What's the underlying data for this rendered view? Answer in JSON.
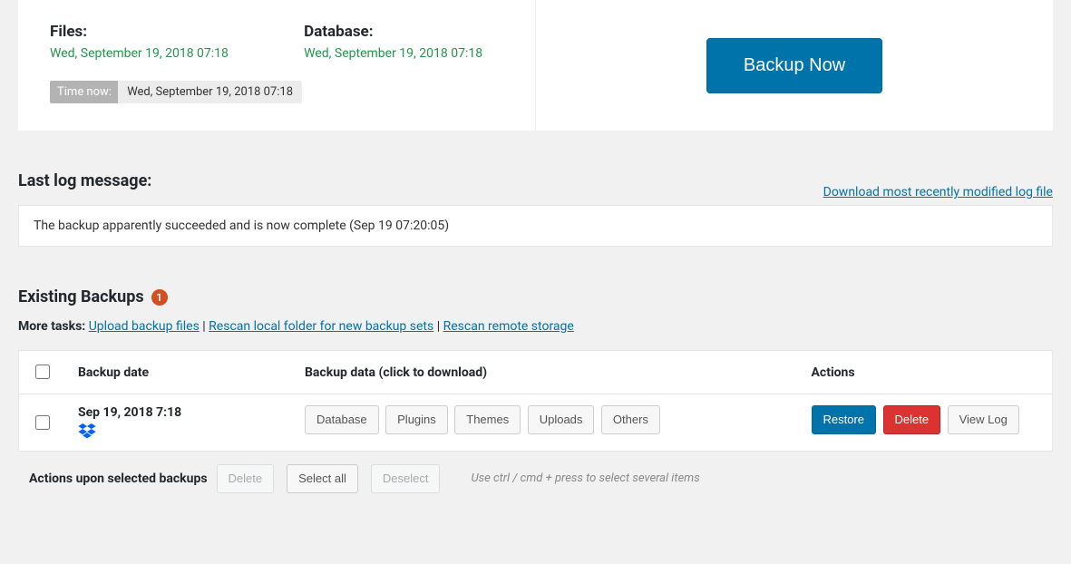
{
  "schedule": {
    "files_label": "Files:",
    "files_date": "Wed, September 19, 2018 07:18",
    "db_label": "Database:",
    "db_date": "Wed, September 19, 2018 07:18",
    "time_now_label": "Time now:",
    "time_now_value": "Wed, September 19, 2018 07:18"
  },
  "backup_now_label": "Backup Now",
  "log": {
    "heading": "Last log message:",
    "download_link": "Download most recently modified log file",
    "message": "The backup apparently succeeded and is now complete (Sep 19 07:20:05)"
  },
  "existing": {
    "heading": "Existing Backups",
    "count": "1",
    "more_tasks_label": "More tasks:",
    "upload_link": "Upload backup files",
    "rescan_local_link": "Rescan local folder for new backup sets",
    "rescan_remote_link": "Rescan remote storage",
    "columns": {
      "date": "Backup date",
      "data": "Backup data (click to download)",
      "actions": "Actions"
    },
    "row": {
      "date": "Sep 19, 2018 7:18",
      "storage_icon": "dropbox-icon",
      "data_buttons": {
        "database": "Database",
        "plugins": "Plugins",
        "themes": "Themes",
        "uploads": "Uploads",
        "others": "Others"
      },
      "restore": "Restore",
      "delete": "Delete",
      "view_log": "View Log"
    }
  },
  "footer": {
    "label": "Actions upon selected backups",
    "delete": "Delete",
    "select_all": "Select all",
    "deselect": "Deselect",
    "hint": "Use ctrl / cmd + press to select several items"
  }
}
